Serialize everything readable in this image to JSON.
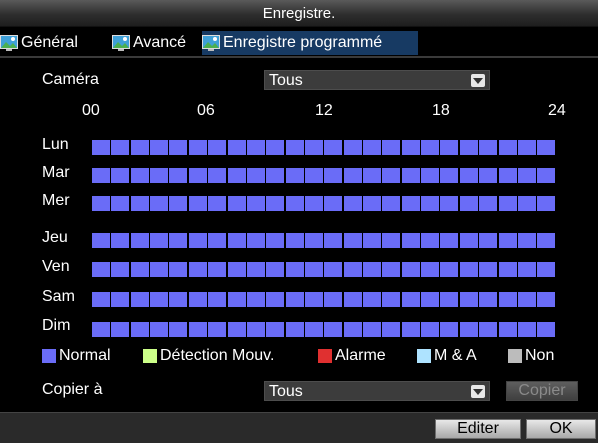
{
  "window": {
    "title": "Enregistre."
  },
  "tabs": [
    {
      "label": "Général",
      "active": false,
      "icon": "monitor-icon"
    },
    {
      "label": "Avancé",
      "active": false,
      "icon": "monitor-icon"
    },
    {
      "label": "Enregistre programmé",
      "active": true,
      "icon": "monitor-icon"
    }
  ],
  "camera": {
    "label": "Caméra",
    "value": "Tous"
  },
  "hours": [
    "00",
    "06",
    "12",
    "18",
    "24"
  ],
  "days": [
    "Lun",
    "Mar",
    "Mer",
    "Jeu",
    "Ven",
    "Sam",
    "Dim"
  ],
  "schedule": {
    "slots_per_day": 24,
    "type_all": "Normal"
  },
  "legend": [
    {
      "label": "Normal",
      "color": "#6a6cf7"
    },
    {
      "label": "Détection Mouv.",
      "color": "#ccff88"
    },
    {
      "label": "Alarme",
      "color": "#e03030"
    },
    {
      "label": "M & A",
      "color": "#aee3ff"
    },
    {
      "label": "Non",
      "color": "#bcbcbc"
    }
  ],
  "copy": {
    "label": "Copier à",
    "value": "Tous",
    "button": "Copier"
  },
  "footer": {
    "edit_label": "Editer",
    "ok_label": "OK"
  }
}
